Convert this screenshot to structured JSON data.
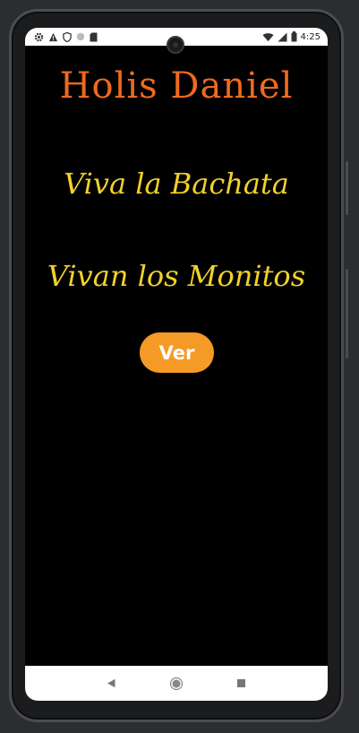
{
  "status_bar": {
    "time": "4:25",
    "left_icons": [
      "gear-icon",
      "warning-icon",
      "shield-icon",
      "circle-icon",
      "sd-card-icon"
    ],
    "right_icons": [
      "wifi-icon",
      "signal-icon",
      "battery-icon"
    ]
  },
  "main": {
    "title": "Holis Daniel",
    "line1": "Viva la Bachata",
    "line2": "Vivan los Monitos",
    "button_label": "Ver"
  },
  "nav_bar": {
    "icons": [
      "back-icon",
      "home-icon",
      "recents-icon"
    ]
  },
  "colors": {
    "title": "#ef6a1e",
    "script_text": "#f2d12a",
    "button": "#f59a26",
    "background": "#000000"
  }
}
